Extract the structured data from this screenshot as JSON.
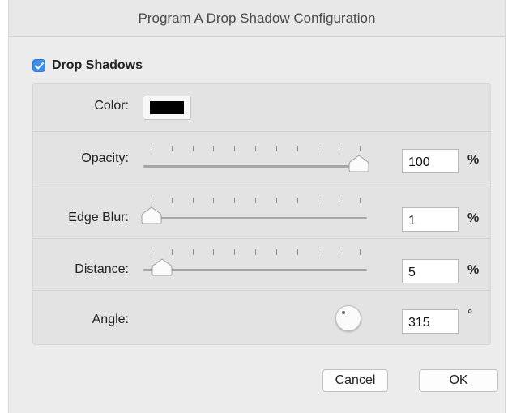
{
  "window": {
    "title": "Program A Drop Shadow Configuration"
  },
  "drop_shadows": {
    "label": "Drop Shadows",
    "checked": true,
    "checkbox_color": "#3c8ee8"
  },
  "color": {
    "label": "Color:",
    "value": "#000000"
  },
  "opacity": {
    "label": "Opacity:",
    "value": "100",
    "unit": "%",
    "slider_fraction": 1.0
  },
  "edge_blur": {
    "label": "Edge Blur:",
    "value": "1",
    "unit": "%",
    "slider_fraction": 0.0
  },
  "distance": {
    "label": "Distance:",
    "value": "5",
    "unit": "%",
    "slider_fraction": 0.05
  },
  "angle": {
    "label": "Angle:",
    "value": "315",
    "unit": "°"
  },
  "buttons": {
    "cancel": "Cancel",
    "ok": "OK"
  },
  "icons": {
    "checkbox": "checkmark-icon",
    "dial": "angle-dial-icon"
  }
}
